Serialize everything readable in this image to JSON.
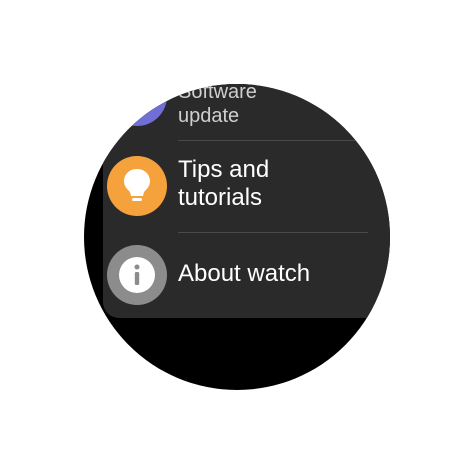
{
  "colors": {
    "background": "#ffffff",
    "watch_face": "#000000",
    "panel": "#2a2a2a",
    "software_icon_bg": "#6f6fd6",
    "tips_icon_bg": "#f5a23c",
    "about_icon_bg": "#8c8c8c"
  },
  "menu": {
    "items": [
      {
        "id": "software-update",
        "label": "Software\nupdate",
        "icon": "software-update-icon"
      },
      {
        "id": "tips-and-tutorials",
        "label": "Tips and\ntutorials",
        "icon": "lightbulb-icon"
      },
      {
        "id": "about-watch",
        "label": "About watch",
        "icon": "info-icon"
      }
    ]
  }
}
